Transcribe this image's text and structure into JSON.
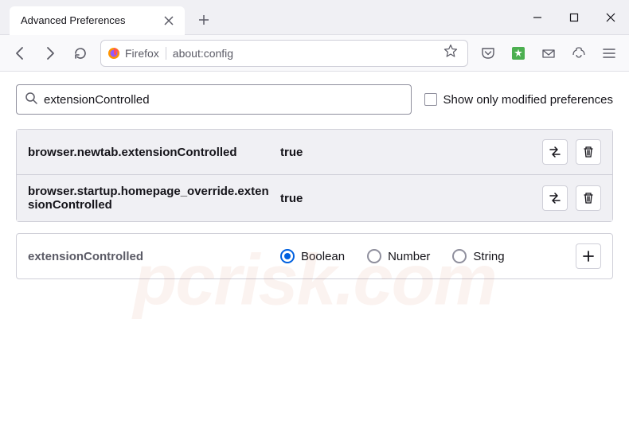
{
  "tab": {
    "title": "Advanced Preferences"
  },
  "urlbar": {
    "identity_label": "Firefox",
    "url": "about:config"
  },
  "search": {
    "value": "extensionControlled",
    "checkbox_label": "Show only modified preferences"
  },
  "prefs": [
    {
      "name": "browser.newtab.extensionControlled",
      "value": "true"
    },
    {
      "name": "browser.startup.homepage_override.extensionControlled",
      "value": "true"
    }
  ],
  "new_pref": {
    "name": "extensionControlled",
    "types": [
      "Boolean",
      "Number",
      "String"
    ],
    "selected": "Boolean"
  },
  "watermark": "pcrisk.com"
}
